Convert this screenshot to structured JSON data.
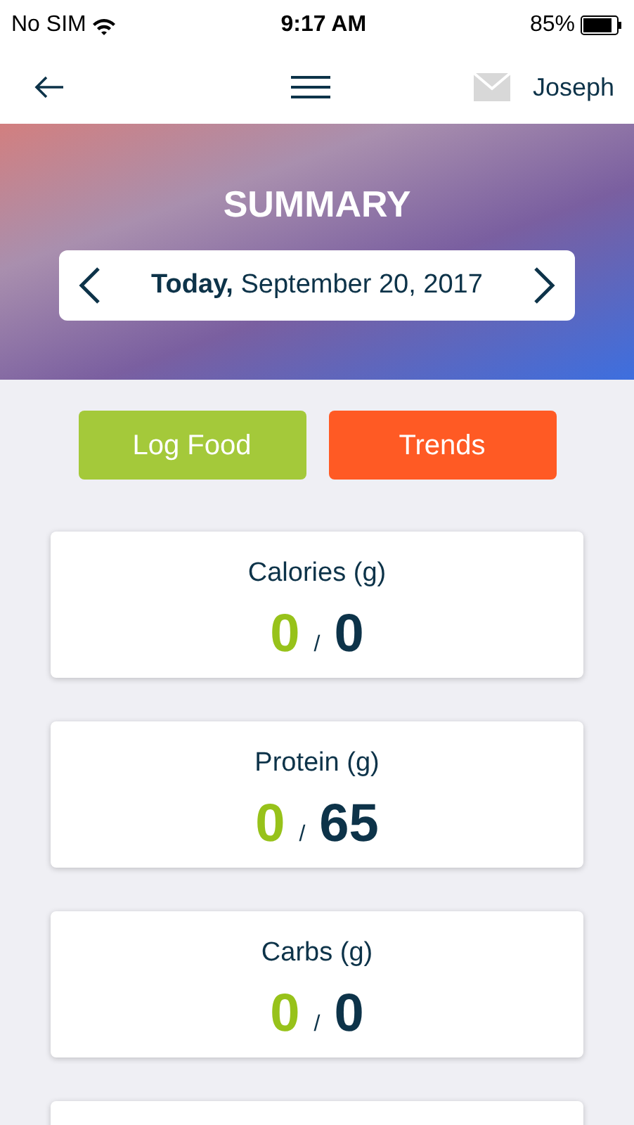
{
  "status_bar": {
    "carrier": "No SIM",
    "time": "9:17 AM",
    "battery": "85%"
  },
  "nav": {
    "user": "Joseph"
  },
  "header": {
    "title": "SUMMARY",
    "date": "**Today,** September 20, 2017"
  },
  "buttons": [
    {
      "label": "Log Food",
      "kind": "log"
    },
    {
      "label": "Trends",
      "kind": "trends"
    }
  ],
  "cards": [
    {
      "title": "Calories (g)",
      "current": "0",
      "separator": "/",
      "goal": "0"
    },
    {
      "title": "Protein (g)",
      "current": "0",
      "separator": "/",
      "goal": "65"
    },
    {
      "title": "Carbs (g)",
      "current": "0",
      "separator": "/",
      "goal": "0"
    }
  ]
}
